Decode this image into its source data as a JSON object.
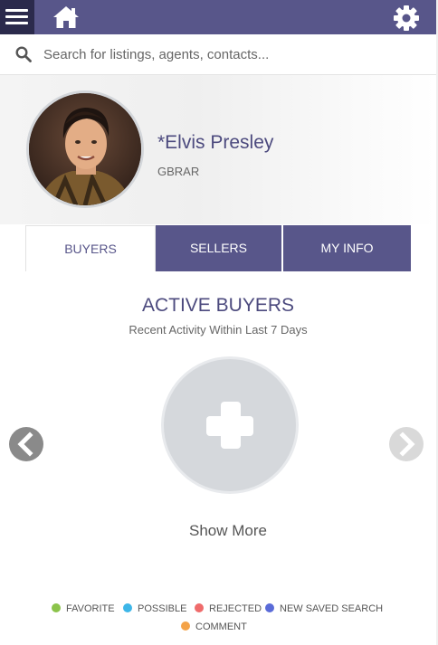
{
  "header": {
    "menu_icon": "hamburger-menu-icon",
    "home_icon": "home-icon",
    "settings_icon": "gear-icon",
    "bar_color": "#58568a",
    "menu_bg": "#2b2a4c"
  },
  "search": {
    "placeholder": "Search for listings, agents, contacts...",
    "value": "",
    "icon": "search-icon"
  },
  "profile": {
    "name": "*Elvis Presley",
    "org": "GBRAR"
  },
  "tabs": [
    {
      "label": "BUYERS",
      "active": true
    },
    {
      "label": "SELLERS",
      "active": false
    },
    {
      "label": "MY INFO",
      "active": false
    }
  ],
  "panel": {
    "title": "ACTIVE BUYERS",
    "subtitle": "Recent Activity Within Last 7 Days",
    "add_icon": "plus-icon",
    "show_more": "Show More",
    "prev_icon": "chevron-left-icon",
    "next_icon": "chevron-right-icon"
  },
  "legend": [
    {
      "label": "FAVORITE",
      "color": "#8bc34a"
    },
    {
      "label": "POSSIBLE",
      "color": "#3db6e8"
    },
    {
      "label": "REJECTED",
      "color": "#ef6b6b"
    },
    {
      "label": "NEW SAVED SEARCH",
      "color": "#5a6bd8"
    },
    {
      "label": "COMMENT",
      "color": "#f4a348"
    }
  ]
}
